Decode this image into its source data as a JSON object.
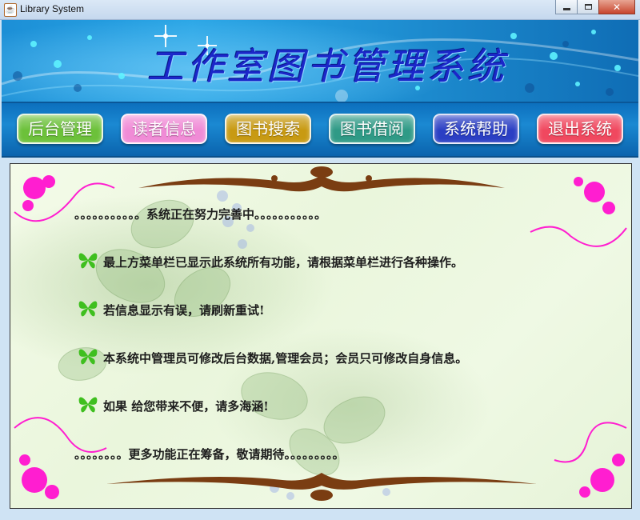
{
  "window": {
    "title": "Library System"
  },
  "banner": {
    "title": "工作室图书管理系统"
  },
  "nav": {
    "items": [
      {
        "label": "后台管理",
        "color": "#6cc13a"
      },
      {
        "label": "读者信息",
        "color": "#f08bd6"
      },
      {
        "label": "图书搜索",
        "color": "#c89a12"
      },
      {
        "label": "图书借阅",
        "color": "#2f9a86"
      },
      {
        "label": "系统帮助",
        "color": "#2b3fc4"
      },
      {
        "label": "退出系统",
        "color": "#f0485f"
      }
    ]
  },
  "content": {
    "header_line": "。。。。。。。。。。。系统正在努力完善中。。。。。。。。。。。",
    "items": [
      "最上方菜单栏已显示此系统所有功能，请根据菜单栏进行各种操作。",
      "若信息显示有误，请刷新重试!",
      "本系统中管理员可修改后台数据,管理会员；会员只可修改自身信息。",
      "如果 给您带来不便，请多海涵!"
    ],
    "footer_line": "。。。。。。。。更多功能正在筹备，敬请期待。。。。。。。。。"
  }
}
